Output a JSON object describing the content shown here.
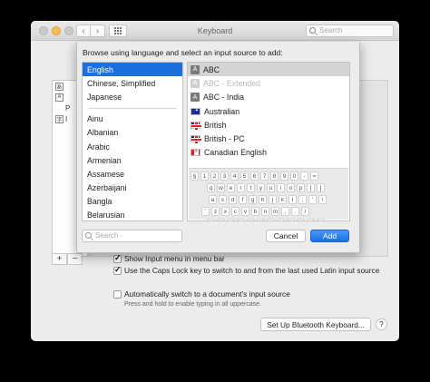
{
  "window": {
    "title": "Keyboard",
    "search_placeholder": "Search"
  },
  "background": {
    "sources": [
      {
        "glyph": "あ",
        "label": ""
      },
      {
        "glyph": "A",
        "label": ""
      },
      {
        "glyph": "",
        "label": "P"
      },
      {
        "glyph": "字",
        "label": "I"
      }
    ],
    "options": {
      "show_input_menu": "Show Input menu in menu bar",
      "caps_lock": "Use the Caps Lock key to switch to and from the last used Latin input source",
      "caps_lock_note": "Press and hold to enable typing in all uppercase.",
      "auto_switch": "Automatically switch to a document's input source"
    },
    "bluetooth_button": "Set Up Bluetooth Keyboard...",
    "help": "?",
    "plus": "+",
    "minus": "−"
  },
  "sheet": {
    "prompt": "Browse using language and select an input source to add:",
    "languages_top": [
      "English",
      "Chinese, Simplified",
      "Japanese"
    ],
    "languages_rest": [
      "Ainu",
      "Albanian",
      "Arabic",
      "Armenian",
      "Assamese",
      "Azerbaijani",
      "Bangla",
      "Belarusian"
    ],
    "sources": [
      {
        "icon": "A",
        "label": "ABC"
      },
      {
        "icon": "A",
        "label": "ABC - Extended"
      },
      {
        "icon": "A",
        "label": "ABC - India"
      },
      {
        "icon": "au",
        "label": "Australian"
      },
      {
        "icon": "gb",
        "label": "British"
      },
      {
        "icon": "gb",
        "label": "British - PC"
      },
      {
        "icon": "ca",
        "label": "Canadian English"
      }
    ],
    "keyboard_rows": [
      [
        "§",
        "1",
        "2",
        "3",
        "4",
        "5",
        "6",
        "7",
        "8",
        "9",
        "0",
        "-",
        "="
      ],
      [
        "q",
        "w",
        "e",
        "r",
        "t",
        "y",
        "u",
        "i",
        "o",
        "p",
        "[",
        "]"
      ],
      [
        "a",
        "s",
        "d",
        "f",
        "g",
        "h",
        "j",
        "k",
        "l",
        ";",
        "'",
        "\\"
      ],
      [
        "`",
        "z",
        "x",
        "c",
        "v",
        "b",
        "n",
        "m",
        ",",
        ".",
        "/"
      ],
      [
        "",
        "",
        "",
        "",
        "",
        "",
        "",
        "",
        "",
        "",
        "",
        ""
      ]
    ],
    "search_placeholder": "Search",
    "cancel": "Cancel",
    "add": "Add"
  },
  "colors": {
    "selection": "#1c6fdc",
    "add_button": "#1a6fe6",
    "minimize": "#f5bf4f"
  }
}
